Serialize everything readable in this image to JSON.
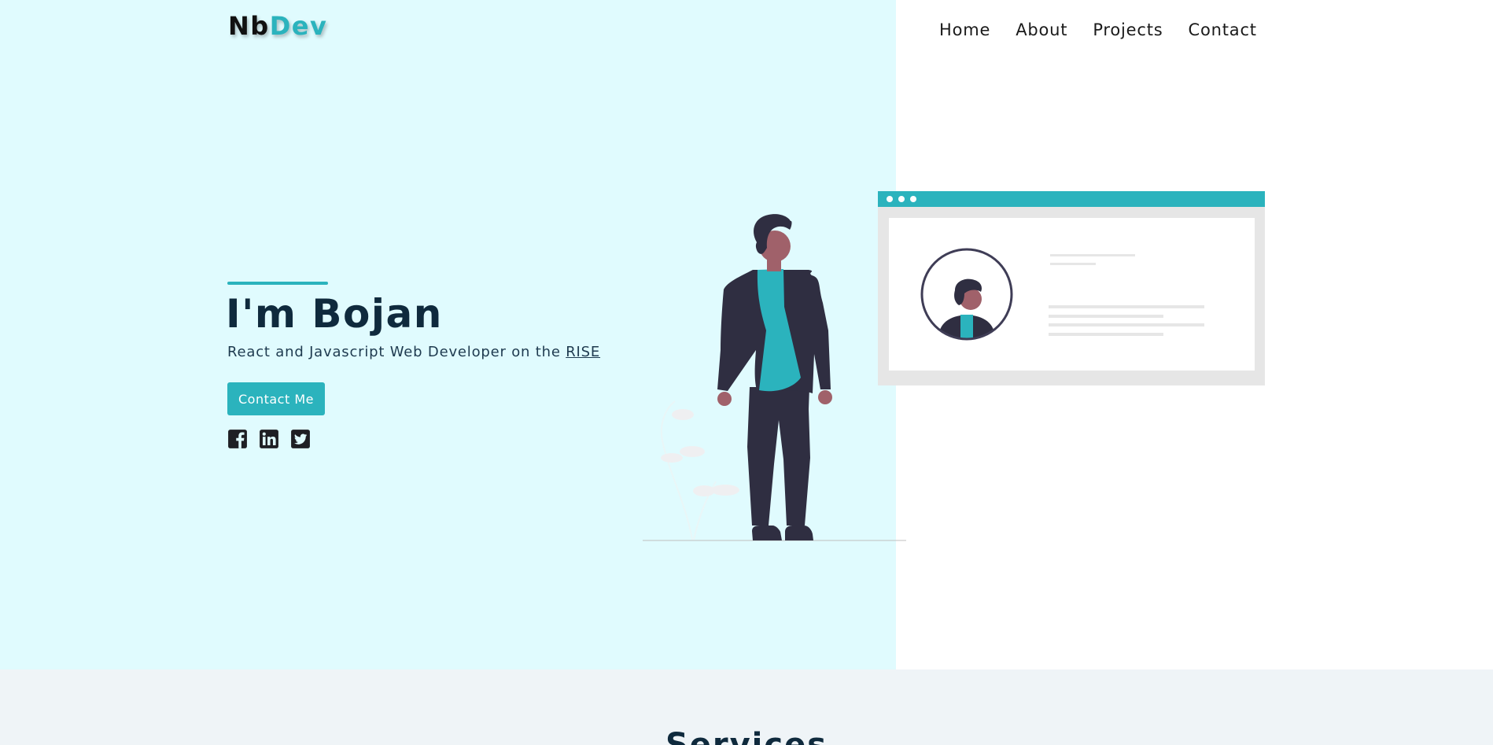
{
  "logo": {
    "part1": "Nb",
    "part2": "Dev"
  },
  "nav": {
    "items": [
      {
        "label": "Home"
      },
      {
        "label": "About"
      },
      {
        "label": "Projects"
      },
      {
        "label": "Contact"
      }
    ]
  },
  "hero": {
    "title": "I'm Bojan",
    "subtitle_prefix": "React and Javascript Web Developer on the ",
    "subtitle_link": "RISE",
    "cta_label": "Contact Me",
    "socials": [
      {
        "icon": "facebook-icon"
      },
      {
        "icon": "linkedin-icon"
      },
      {
        "icon": "twitter-icon"
      }
    ]
  },
  "services": {
    "title": "Services"
  },
  "colors": {
    "accent": "#2bb3bd",
    "hero_bg": "#e0fbfe",
    "dark": "#0f2a3d",
    "band_bg": "#eff4f7"
  }
}
